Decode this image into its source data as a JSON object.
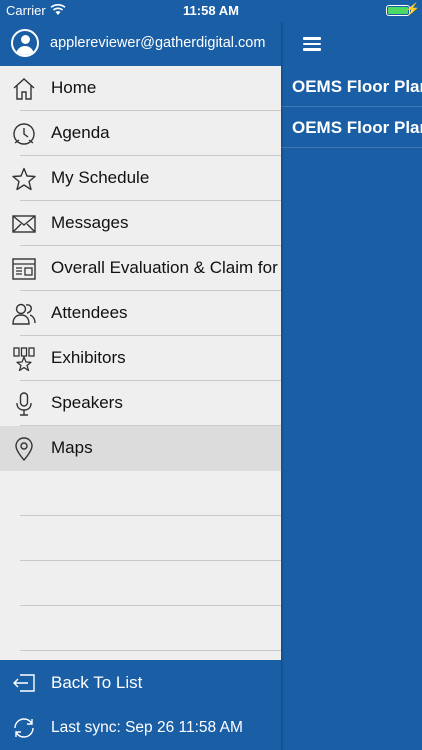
{
  "status_bar": {
    "carrier": "Carrier",
    "time": "11:58 AM",
    "charge_symbol": "⚡"
  },
  "drawer": {
    "user_email": "applereviewer@gatherdigital.com",
    "items": [
      {
        "label": "Home",
        "icon": "home-icon"
      },
      {
        "label": "Agenda",
        "icon": "clock-icon"
      },
      {
        "label": "My Schedule",
        "icon": "star-icon"
      },
      {
        "label": "Messages",
        "icon": "envelope-icon"
      },
      {
        "label": "Overall Evaluation & Claim for",
        "icon": "form-icon"
      },
      {
        "label": "Attendees",
        "icon": "people-icon"
      },
      {
        "label": "Exhibitors",
        "icon": "exhibitors-icon"
      },
      {
        "label": "Speakers",
        "icon": "microphone-icon"
      },
      {
        "label": "Maps",
        "icon": "map-pin-icon",
        "active": true
      }
    ],
    "footer": {
      "back_label": "Back To List",
      "sync_label": "Last sync:  Sep 26 11:58 AM"
    }
  },
  "main": {
    "list": [
      {
        "title": "OEMS Floor Plan"
      },
      {
        "title": "OEMS Floor Plan"
      }
    ]
  },
  "colors": {
    "brand": "#1a5ea6",
    "drawer_bg": "#efefef",
    "active_row": "#dcdcdc",
    "battery": "#4cd964"
  }
}
